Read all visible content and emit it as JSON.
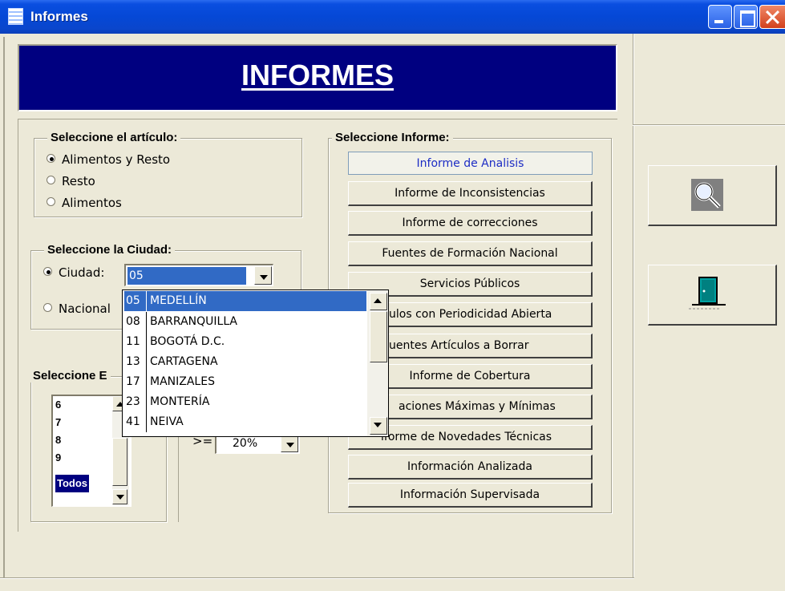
{
  "window": {
    "title": "Informes"
  },
  "banner": {
    "title": "INFORMES"
  },
  "articulo": {
    "legend": "Seleccione  el artículo:",
    "options": [
      {
        "label": "Alimentos y Resto",
        "checked": true
      },
      {
        "label": "Resto",
        "checked": false
      },
      {
        "label": "Alimentos",
        "checked": false
      }
    ]
  },
  "ciudad": {
    "legend": "Seleccione la Ciudad:",
    "ciudad_label": "Ciudad:",
    "nacional_label": "Nacional",
    "selected_value": "05",
    "dropdown_options": [
      {
        "code": "05",
        "name": "MEDELLÍN",
        "selected": true
      },
      {
        "code": "08",
        "name": "BARRANQUILLA"
      },
      {
        "code": "11",
        "name": "BOGOTÁ D.C."
      },
      {
        "code": "13",
        "name": "CARTAGENA"
      },
      {
        "code": "17",
        "name": "MANIZALES"
      },
      {
        "code": "23",
        "name": "MONTERÍA"
      },
      {
        "code": "41",
        "name": "NEIVA"
      }
    ]
  },
  "third_group": {
    "legend_visible": "Seleccione E",
    "list_items": [
      "6",
      "7",
      "8",
      "9",
      "Todos"
    ],
    "selected_item": "Todos",
    "operator": ">=",
    "percent_value": "20%"
  },
  "informe": {
    "legend": "Seleccione Informe:",
    "buttons": [
      "Informe de Analisis",
      "Informe de Inconsistencias",
      "Informe de correcciones",
      "Fuentes de Formación Nacional",
      "Servicios Públicos",
      "ulos con Periodicidad Abierta",
      "uentes Artículos a Borrar",
      "Informe de Cobertura",
      "aciones Máximas y Mínimas",
      "ıforme de Novedades Técnicas",
      "Información Analizada",
      "Información Supervisada"
    ]
  },
  "side_buttons": [
    {
      "icon": "magnifier-icon"
    },
    {
      "icon": "exit-door-icon"
    }
  ],
  "colors": {
    "titlebar": "#0548d6",
    "banner": "#000080",
    "selection": "#316ac5",
    "face": "#ece9d8"
  }
}
